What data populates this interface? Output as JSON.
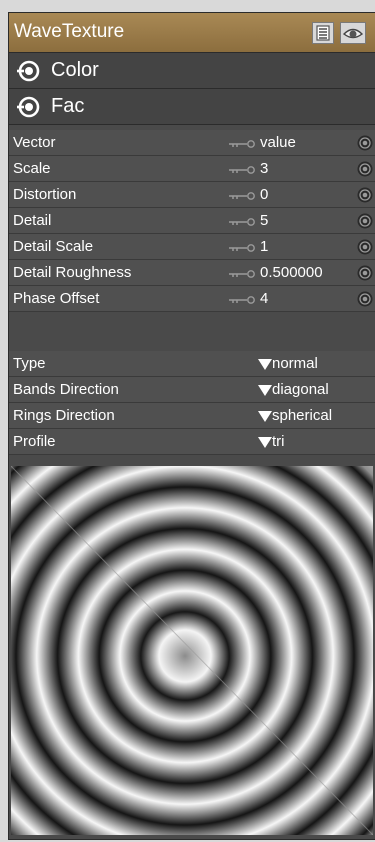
{
  "node": {
    "title": "WaveTexture",
    "menu_icon": "list-icon",
    "visibility_icon": "eye-icon"
  },
  "outputs": [
    {
      "label": "Color"
    },
    {
      "label": "Fac"
    }
  ],
  "inputs": [
    {
      "label": "Vector",
      "value": "value"
    },
    {
      "label": "Scale",
      "value": "3"
    },
    {
      "label": "Distortion",
      "value": "0"
    },
    {
      "label": "Detail",
      "value": "5"
    },
    {
      "label": "Detail Scale",
      "value": "1"
    },
    {
      "label": "Detail Roughness",
      "value": "0.500000"
    },
    {
      "label": "Phase Offset",
      "value": "4"
    }
  ],
  "dropdowns": [
    {
      "label": "Type",
      "value": "normal"
    },
    {
      "label": "Bands Direction",
      "value": "diagonal"
    },
    {
      "label": "Rings Direction",
      "value": "spherical"
    },
    {
      "label": "Profile",
      "value": "tri"
    }
  ],
  "colors": {
    "title_bar": "#9c7c4a",
    "panel": "#4a4a4a",
    "row": "#505050"
  }
}
